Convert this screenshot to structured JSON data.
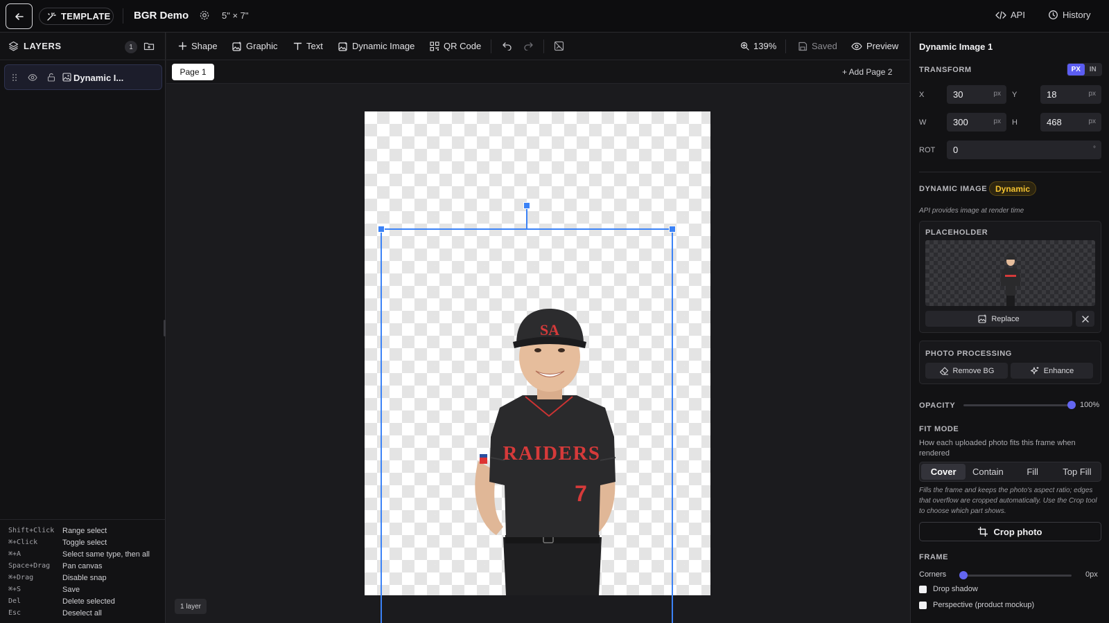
{
  "topbar": {
    "mode_label": "TEMPLATE",
    "project_title": "BGR Demo",
    "page_size": "5\" × 7\"",
    "api_label": "API",
    "history_label": "History"
  },
  "layers_panel": {
    "title": "LAYERS",
    "count": "1",
    "items": [
      {
        "label": "Dynamic I..."
      }
    ]
  },
  "shortcuts": [
    {
      "key": "Shift+Click",
      "desc": "Range select"
    },
    {
      "key": "⌘+Click",
      "desc": "Toggle select"
    },
    {
      "key": "⌘+A",
      "desc": "Select same type, then all"
    },
    {
      "key": "Space+Drag",
      "desc": "Pan canvas"
    },
    {
      "key": "⌘+Drag",
      "desc": "Disable snap"
    },
    {
      "key": "⌘+S",
      "desc": "Save"
    },
    {
      "key": "Del",
      "desc": "Delete selected"
    },
    {
      "key": "Esc",
      "desc": "Deselect all"
    }
  ],
  "toolbar": {
    "shape": "Shape",
    "graphic": "Graphic",
    "text": "Text",
    "dynamic_image": "Dynamic Image",
    "qr_code": "QR Code",
    "zoom": "139%",
    "saved": "Saved",
    "preview": "Preview"
  },
  "pages": {
    "current": "Page 1",
    "add_label": "+ Add Page 2"
  },
  "canvas": {
    "layer_count": "1 layer"
  },
  "inspector": {
    "title": "Dynamic Image 1",
    "transform": {
      "label": "TRANSFORM",
      "unit_px": "PX",
      "unit_in": "IN",
      "active_unit": "PX",
      "x_label": "X",
      "x": "30",
      "y_label": "Y",
      "y": "18",
      "w_label": "W",
      "w": "300",
      "h_label": "H",
      "h": "468",
      "rot_label": "ROT",
      "rot": "0",
      "px_unit": "px",
      "deg_unit": "°"
    },
    "dynamic_image": {
      "label": "DYNAMIC IMAGE",
      "badge": "Dynamic",
      "note": "API provides image at render time"
    },
    "placeholder": {
      "label": "PLACEHOLDER",
      "replace": "Replace"
    },
    "photo_processing": {
      "label": "PHOTO PROCESSING",
      "remove_bg": "Remove BG",
      "enhance": "Enhance"
    },
    "opacity": {
      "label": "OPACITY",
      "value": "100%",
      "level": 1.0
    },
    "fit_mode": {
      "label": "FIT MODE",
      "description": "How each uploaded photo fits this frame when rendered",
      "options": [
        "Cover",
        "Contain",
        "Fill",
        "Top Fill"
      ],
      "selected": "Cover",
      "help": "Fills the frame and keeps the photo's aspect ratio; edges that overflow are cropped automatically. Use the Crop tool to choose which part shows."
    },
    "crop_label": "Crop photo",
    "frame": {
      "label": "FRAME",
      "corners_label": "Corners",
      "corners_value": "0px",
      "corners_level": 0.0,
      "drop_shadow": "Drop shadow",
      "perspective": "Perspective (product mockup)"
    }
  },
  "photo_text": {
    "jersey": "RAIDERS",
    "number": "7",
    "cap": "SA"
  },
  "colors": {
    "accent": "#5b5df2",
    "selection": "#3b82f6",
    "dynamic_badge": "#f5c330",
    "jersey": "#2a2a2c",
    "jersey_lettering": "#d63a3a"
  }
}
